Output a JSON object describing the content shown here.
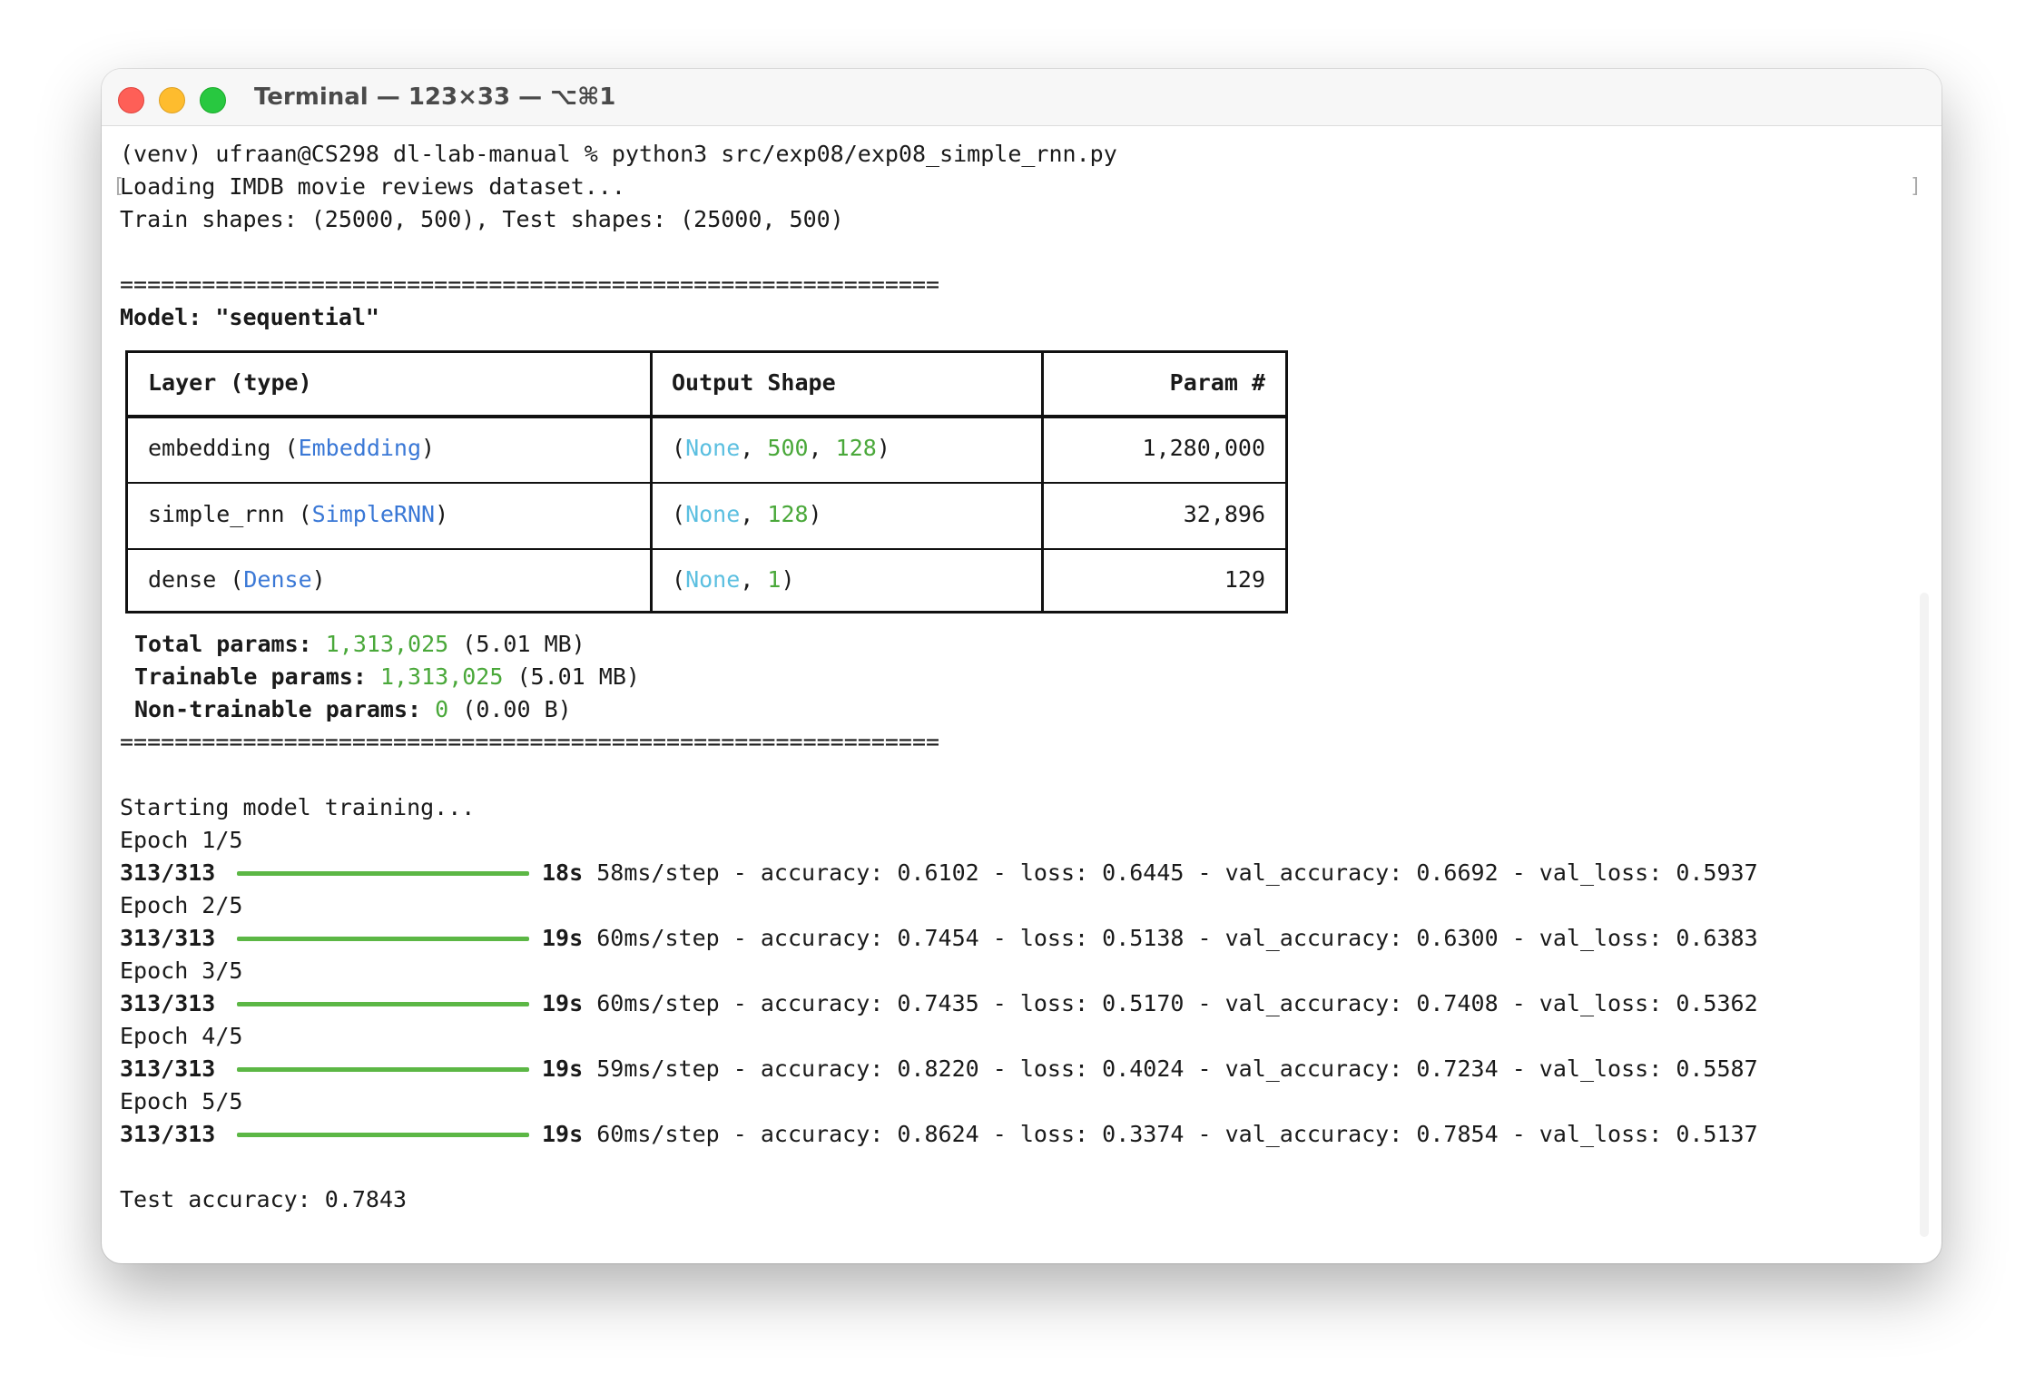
{
  "window": {
    "title": "Terminal — 123×33 — ⌥⌘1"
  },
  "terminal": {
    "prompt": "(venv) ufraan@CS298 dl-lab-manual % python3 src/exp08/exp08_simple_rnn.py",
    "loading": "Loading IMDB movie reviews dataset...",
    "shapes": "Train shapes: (25000, 500), Test shapes: (25000, 500)",
    "separator": "============================================================",
    "model_line": "Model: \"sequential\"",
    "table": {
      "headers": [
        "Layer (type)",
        "Output Shape",
        "Param #"
      ],
      "rows": [
        {
          "name": "embedding",
          "type": "Embedding",
          "shape_none": "None",
          "shape_dims": [
            "500",
            "128"
          ],
          "params": "1,280,000"
        },
        {
          "name": "simple_rnn",
          "type": "SimpleRNN",
          "shape_none": "None",
          "shape_dims": [
            "128"
          ],
          "params": "32,896"
        },
        {
          "name": "dense",
          "type": "Dense",
          "shape_none": "None",
          "shape_dims": [
            "1"
          ],
          "params": "129"
        }
      ]
    },
    "summary": [
      {
        "label": "Total params:",
        "value": "1,313,025",
        "size": "(5.01 MB)"
      },
      {
        "label": "Trainable params:",
        "value": "1,313,025",
        "size": "(5.01 MB)"
      },
      {
        "label": "Non-trainable params:",
        "value": "0",
        "size": "(0.00 B)"
      }
    ],
    "training_start": "Starting model training...",
    "epochs": [
      {
        "label": "Epoch 1/5",
        "steps": "313/313",
        "progress": 1.0,
        "time": "18s",
        "step_time": "58ms/step",
        "accuracy": "0.6102",
        "loss": "0.6445",
        "val_accuracy": "0.6692",
        "val_loss": "0.5937"
      },
      {
        "label": "Epoch 2/5",
        "steps": "313/313",
        "progress": 1.0,
        "time": "19s",
        "step_time": "60ms/step",
        "accuracy": "0.7454",
        "loss": "0.5138",
        "val_accuracy": "0.6300",
        "val_loss": "0.6383"
      },
      {
        "label": "Epoch 3/5",
        "steps": "313/313",
        "progress": 1.0,
        "time": "19s",
        "step_time": "60ms/step",
        "accuracy": "0.7435",
        "loss": "0.5170",
        "val_accuracy": "0.7408",
        "val_loss": "0.5362"
      },
      {
        "label": "Epoch 4/5",
        "steps": "313/313",
        "progress": 1.0,
        "time": "19s",
        "step_time": "59ms/step",
        "accuracy": "0.8220",
        "loss": "0.4024",
        "val_accuracy": "0.7234",
        "val_loss": "0.5587"
      },
      {
        "label": "Epoch 5/5",
        "steps": "313/313",
        "progress": 1.0,
        "time": "19s",
        "step_time": "60ms/step",
        "accuracy": "0.8624",
        "loss": "0.3374",
        "val_accuracy": "0.7854",
        "val_loss": "0.5137"
      }
    ],
    "test_result": "Test accuracy: 0.7843"
  },
  "colors": {
    "number": "#4aa83a",
    "none_keyword": "#5bbfe0",
    "class_name": "#3a78d6",
    "progress_bar": "#5cb745"
  }
}
